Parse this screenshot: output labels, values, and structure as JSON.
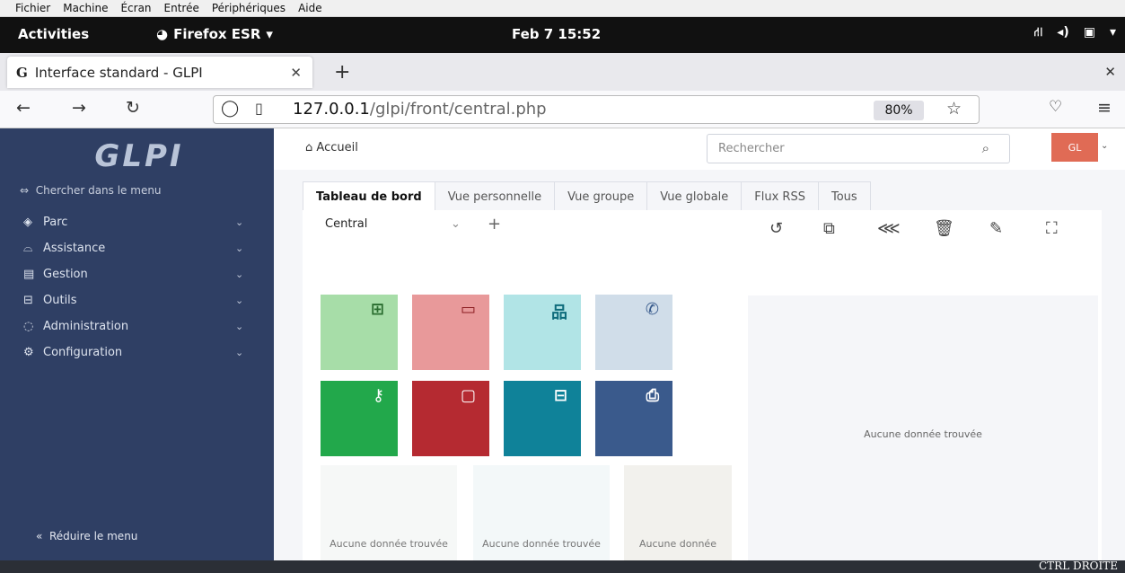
{
  "vm_menu": [
    "Fichier",
    "Machine",
    "Écran",
    "Entrée",
    "Périphériques",
    "Aide"
  ],
  "gnome": {
    "activities": "Activities",
    "app": "Firefox ESR",
    "clock": "Feb 7  15:52"
  },
  "browser": {
    "tab_title": "Interface standard - GLPI",
    "url_host": "127.0.0.1",
    "url_path": "/glpi/front/central.php",
    "zoom": "80%"
  },
  "sidebar": {
    "logo": "GLPI",
    "search": "Chercher dans le menu",
    "items": [
      {
        "label": "Parc",
        "icon": "box-icon"
      },
      {
        "label": "Assistance",
        "icon": "headset-icon"
      },
      {
        "label": "Gestion",
        "icon": "wallet-icon"
      },
      {
        "label": "Outils",
        "icon": "briefcase-icon"
      },
      {
        "label": "Administration",
        "icon": "shield-icon"
      },
      {
        "label": "Configuration",
        "icon": "gear-icon"
      }
    ],
    "collapse": "Réduire le menu"
  },
  "header": {
    "breadcrumb": "Accueil",
    "search_placeholder": "Rechercher",
    "avatar": "GL"
  },
  "dashboard": {
    "tabs": [
      "Tableau de bord",
      "Vue personnelle",
      "Vue groupe",
      "Vue globale",
      "Flux RSS",
      "Tous"
    ],
    "selected": "Central",
    "no_data": "Aucune donnée trouvée",
    "no_data_short": "Aucune donnée",
    "colors": {
      "software": "#a7dda8",
      "computer": "#e8999a",
      "network": "#b1e4e6",
      "phone": "#d0dde9",
      "license": "#22a84b",
      "monitor": "#b52a31",
      "rack": "#0f8299",
      "printer": "#3a5a8c"
    }
  },
  "vm_status": {
    "host_key": "CTRL DROITE"
  }
}
